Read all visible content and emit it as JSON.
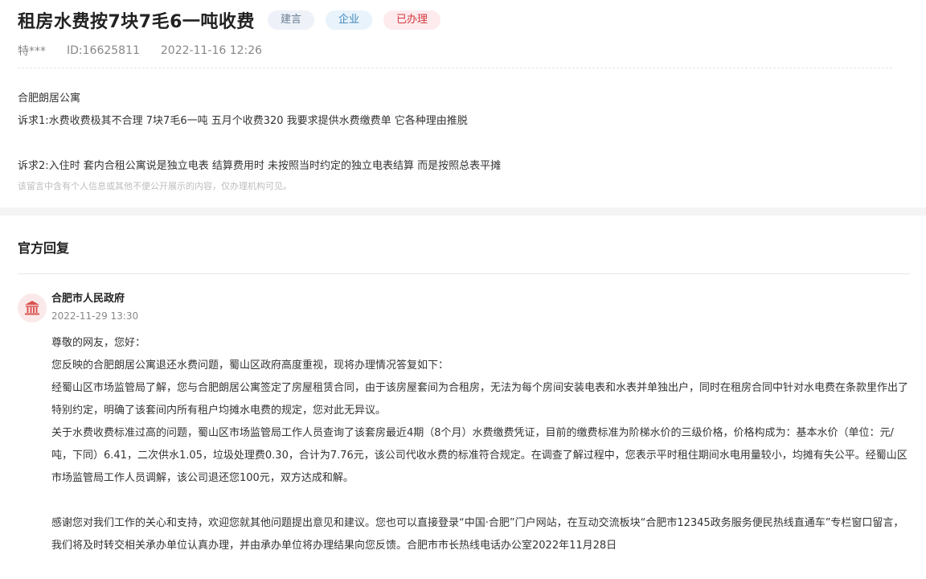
{
  "post": {
    "title": "租房水费按7块7毛6一吨收费",
    "tags": [
      "建言",
      "企业",
      "已办理"
    ],
    "author": "特***",
    "id": "ID:16625811",
    "datetime": "2022-11-16 12:26",
    "content": [
      "合肥朗居公寓",
      "诉求1:水费收费极其不合理 7块7毛6一吨 五月个收费320 我要求提供水费缴费单 它各种理由推脱",
      "诉求2:入住时 套内合租公寓说是独立电表 结算费用时 未按照当时约定的独立电表结算 而是按照总表平摊"
    ],
    "privacy_note": "该留言中含有个人信息或其他不便公开展示的内容，仅办理机构可见。"
  },
  "reply": {
    "section_title": "官方回复",
    "org_name": "合肥市人民政府",
    "org_datetime": "2022-11-29 13:30",
    "org_icon": "government-building-icon",
    "paragraphs": [
      "尊敬的网友，您好：",
      "您反映的合肥朗居公寓退还水费问题，蜀山区政府高度重视，现将办理情况答复如下：",
      "经蜀山区市场监管局了解，您与合肥朗居公寓签定了房屋租赁合同，由于该房屋套间为合租房，无法为每个房间安装电表和水表并单独出户，同时在租房合同中针对水电费在条款里作出了特别约定，明确了该套间内所有租户均摊水电费的规定，您对此无异议。",
      "关于水费收费标准过高的问题，蜀山区市场监管局工作人员查询了该套房最近4期（8个月）水费缴费凭证，目前的缴费标准为阶梯水价的三级价格，价格构成为：基本水价（单位：元/吨，下同）6.41，二次供水1.05，垃圾处理费0.30，合计为7.76元，该公司代收水费的标准符合规定。在调查了解过程中，您表示平时租住期间水电用量较小，均摊有失公平。经蜀山区市场监管局工作人员调解，该公司退还您100元，双方达成和解。",
      "感谢您对我们工作的关心和支持，欢迎您就其他问题提出意见和建议。您也可以直接登录“中国·合肥”门户网站，在互动交流板块“合肥市12345政务服务便民热线直通车”专栏窗口留言，我们将及时转交相关承办单位认真办理，并由承办单位将办理结果向您反馈。合肥市市长热线电话办公室2022年11月28日"
    ]
  },
  "colors": {
    "tag_suggestion": "#6b7d93",
    "tag_enterprise": "#3f86b8",
    "tag_done": "#d4373c",
    "org_icon": "#d9534f"
  }
}
